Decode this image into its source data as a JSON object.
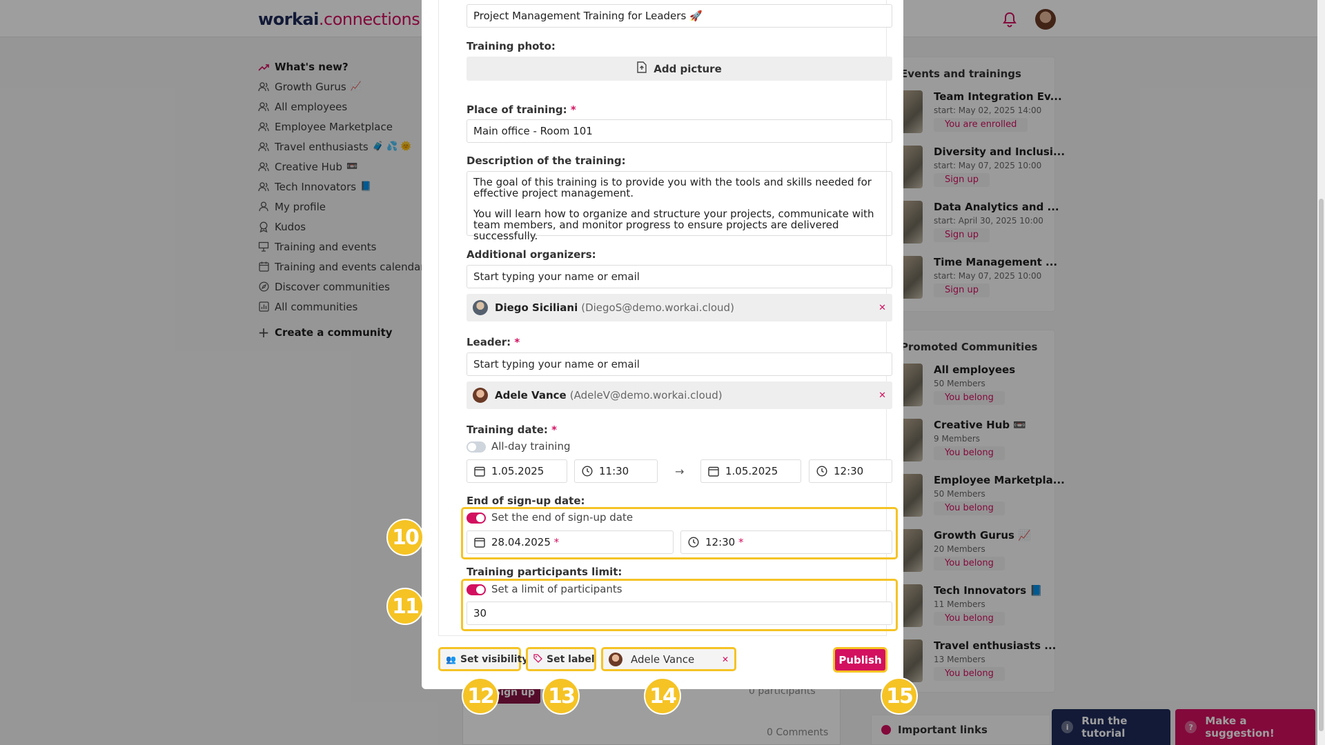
{
  "app": {
    "logo_brand": "workai",
    "logo_suffix": ".connections"
  },
  "sidebar": {
    "items": [
      {
        "label": "What's new?",
        "icon": "trending-icon",
        "emoji": ""
      },
      {
        "label": "Growth Gurus",
        "icon": "people-icon",
        "emoji": "📈"
      },
      {
        "label": "All employees",
        "icon": "people-icon",
        "emoji": ""
      },
      {
        "label": "Employee Marketplace",
        "icon": "people-icon",
        "emoji": ""
      },
      {
        "label": "Travel enthusiasts",
        "icon": "people-icon",
        "emoji": "🧳 💦 🌞"
      },
      {
        "label": "Creative Hub",
        "icon": "people-icon",
        "emoji": "📼"
      },
      {
        "label": "Tech Innovators",
        "icon": "people-icon",
        "emoji": "📘"
      },
      {
        "label": "My profile",
        "icon": "person-icon",
        "emoji": ""
      },
      {
        "label": "Kudos",
        "icon": "award-icon",
        "emoji": ""
      },
      {
        "label": "Training and events",
        "icon": "presentation-icon",
        "emoji": ""
      },
      {
        "label": "Training and events calendar",
        "icon": "calendar-icon",
        "emoji": ""
      },
      {
        "label": "Discover communities",
        "icon": "compass-icon",
        "emoji": ""
      },
      {
        "label": "All communities",
        "icon": "chart-icon",
        "emoji": ""
      }
    ],
    "create_label": "Create a community"
  },
  "events_panel": {
    "title": "Events and trainings",
    "items": [
      {
        "name": "Team Integration Ev...",
        "start": "start: May 02, 2025 14:00",
        "badge": "You are enrolled"
      },
      {
        "name": "Diversity and Inclusi...",
        "start": "start: May 07, 2025 10:00",
        "badge": "Sign up"
      },
      {
        "name": "Data Analytics and ...",
        "start": "start: April 30, 2025 10:00",
        "badge": "Sign up"
      },
      {
        "name": "Time Management ...",
        "start": "start: May 07, 2025 10:00",
        "badge": "Sign up"
      }
    ]
  },
  "communities_panel": {
    "title": "Promoted Communities",
    "items": [
      {
        "name": "All employees",
        "members": "50 Members",
        "badge": "You belong"
      },
      {
        "name": "Creative Hub 📼",
        "members": "9 Members",
        "badge": "You belong"
      },
      {
        "name": "Employee Marketpla...",
        "members": "50 Members",
        "badge": "You belong"
      },
      {
        "name": "Growth Gurus 📈",
        "members": "20 Members",
        "badge": "You belong"
      },
      {
        "name": "Tech Innovators 📘",
        "members": "11 Members",
        "badge": "You belong"
      },
      {
        "name": "Travel enthusiasts ...",
        "members": "13 Members",
        "badge": "You belong"
      }
    ]
  },
  "background_post": {
    "signup_label": "Sign up",
    "participants": "0 participants",
    "comments": "0 Comments"
  },
  "important_links": "Important links",
  "help": {
    "tutorial_label": "Run the tutorial",
    "suggestion_label": "Make a suggestion!"
  },
  "form": {
    "title_value": "Project Management Training for Leaders 🚀",
    "photo_label": "Training photo:",
    "add_picture": "Add picture",
    "place_label": "Place of training:",
    "place_value": "Main office - Room 101",
    "description_label": "Description of the training:",
    "description_p1": "The goal of this training is to provide you with the tools and skills needed for effective project management.",
    "description_p2": "You will learn how to organize and structure your projects, communicate with team members, and monitor progress to ensure projects are delivered successfully.",
    "organizers_label": "Additional organizers:",
    "organizers_placeholder": "Start typing your name or email",
    "organizer": {
      "name": "Diego Siciliani",
      "email": "(DiegoS@demo.workai.cloud)"
    },
    "leader_label": "Leader:",
    "leader_placeholder": "Start typing your name or email",
    "leader": {
      "name": "Adele Vance",
      "email": "(AdeleV@demo.workai.cloud)"
    },
    "date_label": "Training date:",
    "allday_label": "All-day training",
    "allday_on": false,
    "start_date": "1.05.2025",
    "start_time": "11:30",
    "end_date": "1.05.2025",
    "end_time": "12:30",
    "arrow": "→",
    "signup_end_label": "End of sign-up date:",
    "signup_toggle_label": "Set the end of sign-up date",
    "signup_toggle_on": true,
    "signup_date": "28.04.2025",
    "signup_time": "12:30",
    "limit_label": "Training participants limit:",
    "limit_toggle_label": "Set a limit of participants",
    "limit_toggle_on": true,
    "limit_value": "30"
  },
  "footer": {
    "visibility_label": "Set visibility",
    "label_label": "Set label",
    "author_name": "Adele Vance",
    "publish_label": "Publish"
  },
  "callouts": [
    "10",
    "11",
    "12",
    "13",
    "14",
    "15"
  ],
  "colors": {
    "accent": "#d3105f",
    "highlight": "#f5c324",
    "navy": "#1e2a5a"
  }
}
